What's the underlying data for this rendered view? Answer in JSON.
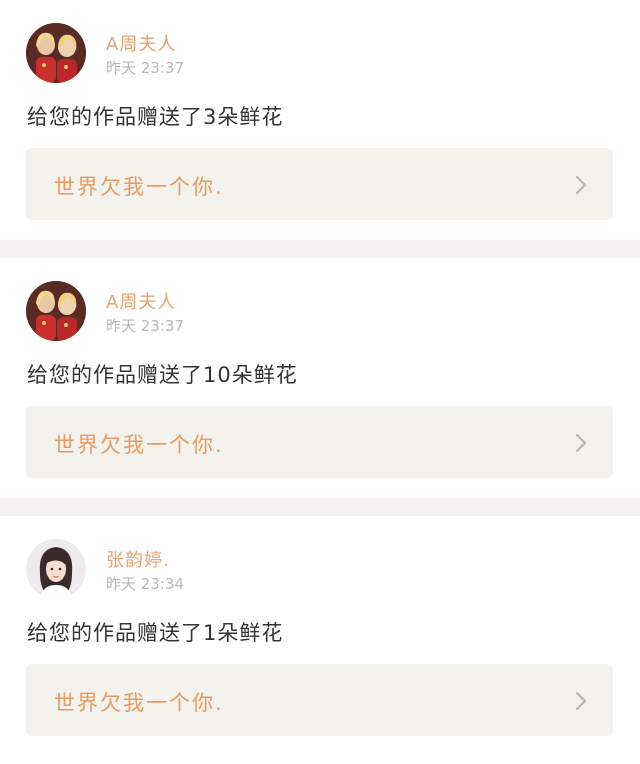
{
  "notifications": [
    {
      "username": "A周夫人",
      "time": "昨天 23:37",
      "message": "给您的作品赠送了3朵鲜花",
      "work_title": "世界欠我一个你.",
      "avatar_icon": "avatar-two-girls"
    },
    {
      "username": "A周夫人",
      "time": "昨天 23:37",
      "message": "给您的作品赠送了10朵鲜花",
      "work_title": "世界欠我一个你.",
      "avatar_icon": "avatar-two-girls"
    },
    {
      "username": "张韵婷.",
      "time": "昨天 23:34",
      "message": "给您的作品赠送了1朵鲜花",
      "work_title": "世界欠我一个你.",
      "avatar_icon": "avatar-girl"
    }
  ],
  "colors": {
    "username": "#e8a36f",
    "work_title": "#e79b63",
    "card_background": "#f3f2ec",
    "page_background": "#f5f3f3"
  }
}
